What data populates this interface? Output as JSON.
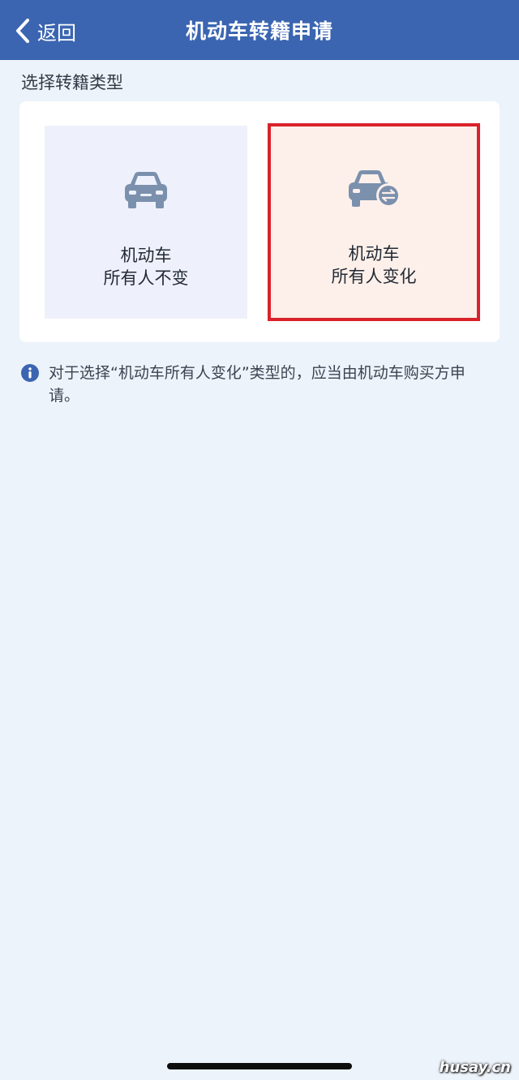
{
  "header": {
    "back_label": "返回",
    "title": "机动车转籍申请",
    "icon": "chevron-left-icon",
    "bg_color": "#3b65b1"
  },
  "section": {
    "label": "选择转籍类型"
  },
  "options": [
    {
      "line1": "机动车",
      "line2": "所有人不变",
      "icon": "car-icon",
      "selected": false
    },
    {
      "line1": "机动车",
      "line2": "所有人变化",
      "icon": "car-transfer-icon",
      "selected": true,
      "highlight_color": "#d9222a"
    }
  ],
  "notice": {
    "icon": "info-icon",
    "text": "对于选择“机动车所有人变化”类型的，应当由机动车购买方申请。"
  },
  "watermark": {
    "text": "husay.cn"
  }
}
